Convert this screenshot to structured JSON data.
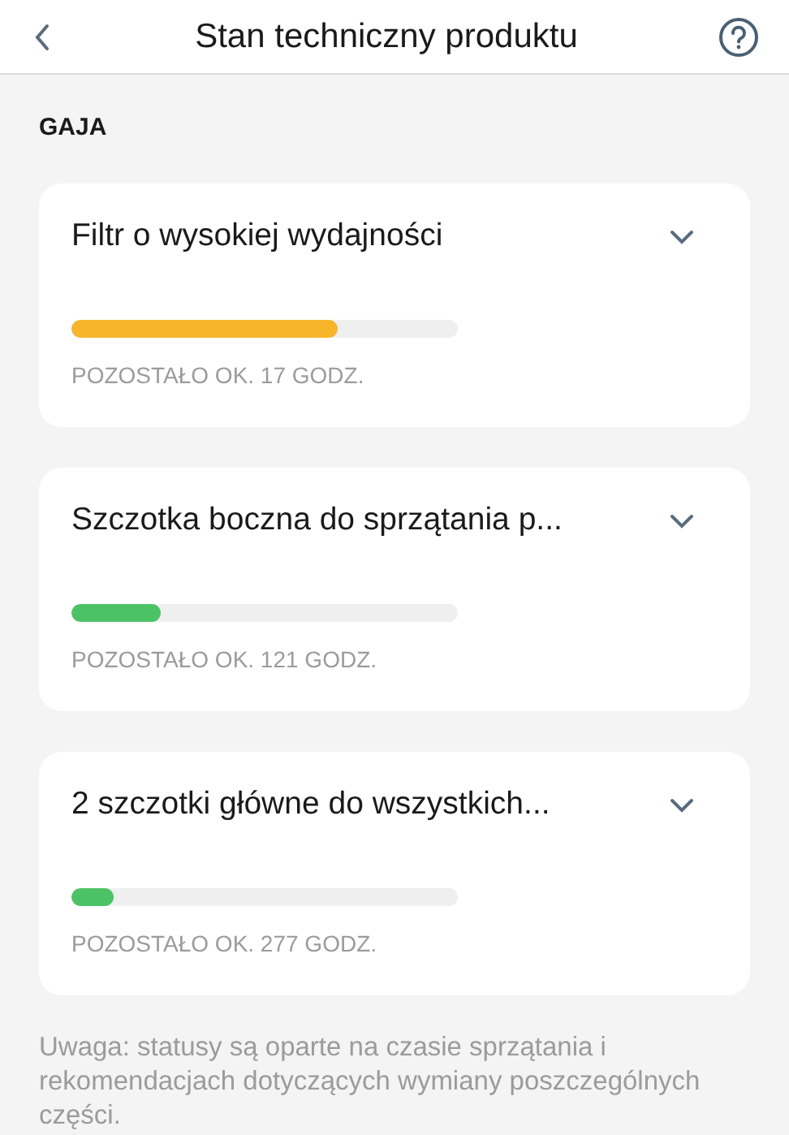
{
  "header": {
    "title": "Stan techniczny produktu"
  },
  "section": {
    "label": "GAJA"
  },
  "parts": [
    {
      "name": "Filtr o wysokiej wydajności",
      "level": 0.69,
      "color": "#f7b52c",
      "remaining": "POZOSTAŁO OK. 17 GODZ."
    },
    {
      "name": "Szczotka boczna do sprzątania p...",
      "level": 0.23,
      "color": "#4cc267",
      "remaining": "POZOSTAŁO OK. 121 GODZ."
    },
    {
      "name": "2 szczotki główne do wszystkich...",
      "level": 0.11,
      "color": "#4cc267",
      "remaining": "POZOSTAŁO OK. 277 GODZ."
    }
  ],
  "note": "Uwaga: statusy są oparte na czasie sprzątania i rekomendacjach dotyczących wymiany poszczególnych części."
}
